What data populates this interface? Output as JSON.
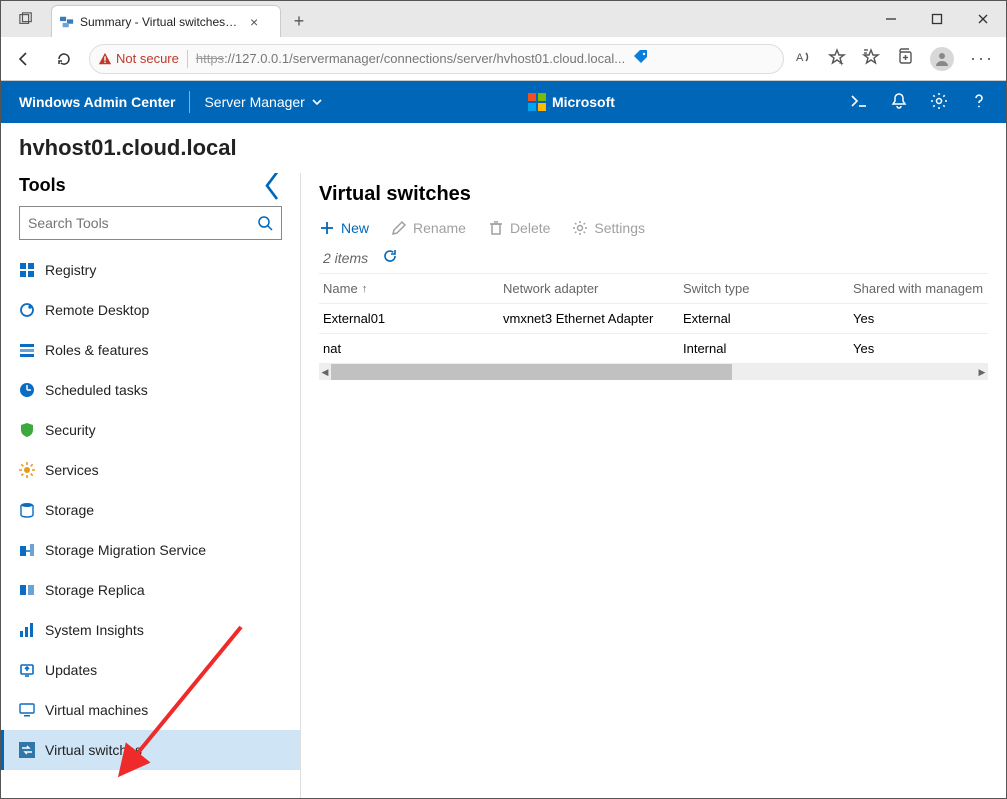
{
  "browser": {
    "tab_title": "Summary - Virtual switches - Ser",
    "not_secure": "Not secure",
    "url_strike": "https",
    "url_rest": "://127.0.0.1/servermanager/connections/server/hvhost01.cloud.local..."
  },
  "header": {
    "brand": "Windows Admin Center",
    "context": "Server Manager",
    "ms": "Microsoft"
  },
  "host_title": "hvhost01.cloud.local",
  "sidebar": {
    "title": "Tools",
    "search_placeholder": "Search Tools",
    "items": [
      {
        "label": "Registry"
      },
      {
        "label": "Remote Desktop"
      },
      {
        "label": "Roles & features"
      },
      {
        "label": "Scheduled tasks"
      },
      {
        "label": "Security"
      },
      {
        "label": "Services"
      },
      {
        "label": "Storage"
      },
      {
        "label": "Storage Migration Service"
      },
      {
        "label": "Storage Replica"
      },
      {
        "label": "System Insights"
      },
      {
        "label": "Updates"
      },
      {
        "label": "Virtual machines"
      },
      {
        "label": "Virtual switches"
      }
    ]
  },
  "main": {
    "heading": "Virtual switches",
    "cmd_new": "New",
    "cmd_rename": "Rename",
    "cmd_delete": "Delete",
    "cmd_settings": "Settings",
    "item_count": "2 items",
    "columns": {
      "name": "Name",
      "net": "Network adapter",
      "type": "Switch type",
      "shared": "Shared with managem"
    },
    "rows": [
      {
        "name": "External01",
        "net": "vmxnet3 Ethernet Adapter",
        "type": "External",
        "shared": "Yes"
      },
      {
        "name": "nat",
        "net": "",
        "type": "Internal",
        "shared": "Yes"
      }
    ]
  }
}
